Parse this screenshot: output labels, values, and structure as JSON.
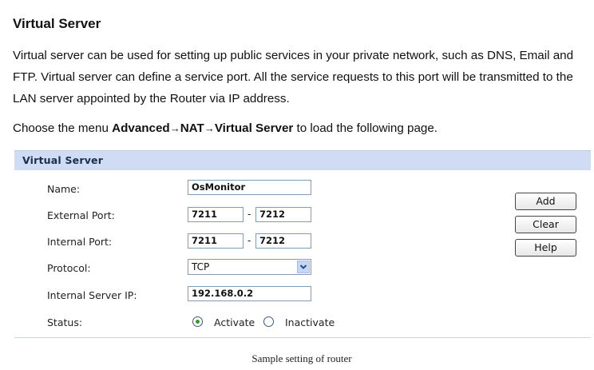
{
  "doc": {
    "title": "Virtual Server",
    "paragraph": "Virtual server can be used for setting up public services in your private network, such as DNS, Email and FTP. Virtual server can define a service port. All the service requests to this port will be transmitted to the LAN server appointed by the Router via IP address.",
    "menu_prefix": "Choose the menu ",
    "menu_path": [
      "Advanced",
      "NAT",
      "Virtual Server"
    ],
    "menu_suffix": " to load the following page."
  },
  "panel": {
    "title": "Virtual Server",
    "name_label": "Name:",
    "name_value": "OsMonitor",
    "external_port_label": "External Port:",
    "external_port_from": "7211",
    "external_port_to": "7212",
    "internal_port_label": "Internal Port:",
    "internal_port_from": "7211",
    "internal_port_to": "7212",
    "port_separator": "-",
    "protocol_label": "Protocol:",
    "protocol_value": "TCP",
    "server_ip_label": "Internal Server IP:",
    "server_ip_value": "192.168.0.2",
    "status_label": "Status:",
    "status_activate": "Activate",
    "status_inactivate": "Inactivate",
    "status_selected": "Activate"
  },
  "buttons": {
    "add": "Add",
    "clear": "Clear",
    "help": "Help"
  },
  "caption": "Sample setting of router",
  "colors": {
    "header_bg": "#cfdcf3",
    "radio_selected": "#2a9d2a"
  },
  "icons": {
    "select_arrow": "chevron-down-icon"
  }
}
